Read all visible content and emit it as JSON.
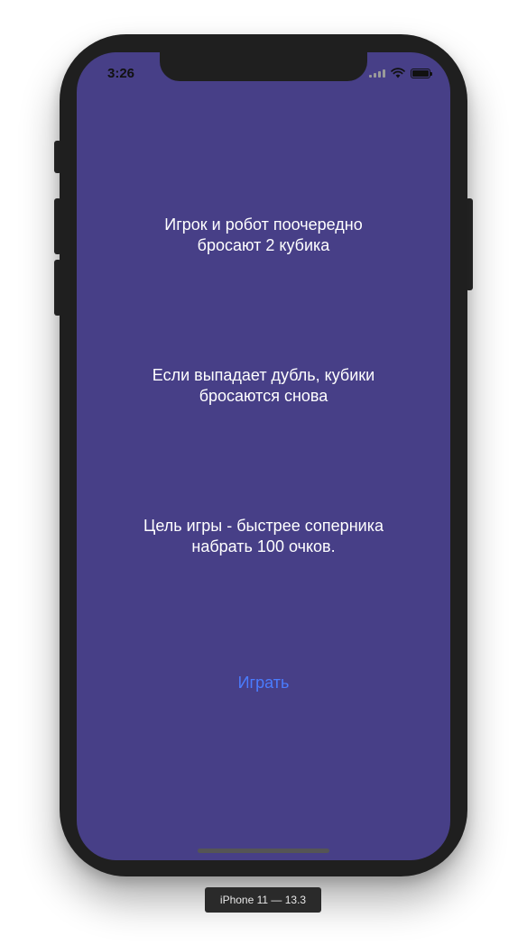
{
  "status_bar": {
    "time": "3:26",
    "icons": [
      "signal-icon",
      "wifi-icon",
      "battery-icon"
    ]
  },
  "rules": {
    "rule_1": "Игрок и робот поочередно\nбросают 2 кубика",
    "rule_2": "Если выпадает дубль, кубики\nбросаются снова",
    "rule_3": "Цель игры - быстрее соперника\nнабрать 100 очков."
  },
  "actions": {
    "play_label": "Играть"
  },
  "device_label": "iPhone 11 — 13.3",
  "colors": {
    "screen_background": "#473f87",
    "text": "#ffffff",
    "accent": "#4a7cff",
    "frame": "#1f1f1f"
  }
}
